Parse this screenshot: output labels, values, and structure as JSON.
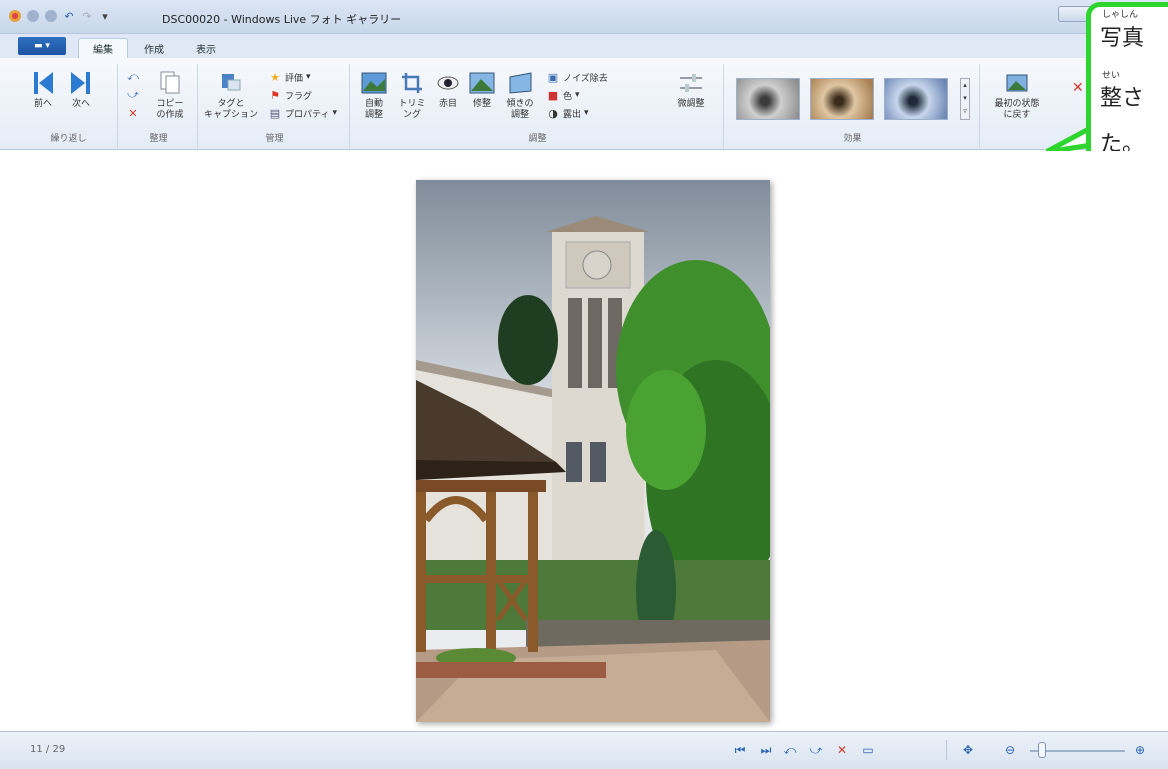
{
  "window": {
    "title": "DSC00020 - Windows Live フォト ギャラリー"
  },
  "tabs": [
    {
      "label": "編集",
      "active": true
    },
    {
      "label": "作成",
      "active": false
    },
    {
      "label": "表示",
      "active": false
    }
  ],
  "ribbon": {
    "navigate": {
      "prev": "前へ",
      "next": "次へ",
      "group": "繰り返し"
    },
    "organize": {
      "copy": "コピー\nの作成",
      "group": "整理"
    },
    "manage": {
      "tag_caption": "タグと\nキャプション",
      "rate": "評価",
      "flag": "フラグ",
      "properties": "プロパティ",
      "group": "管理"
    },
    "adjust": {
      "auto": "自動\n調整",
      "crop": "トリミ\nング",
      "redeye": "赤目",
      "retouch": "修整",
      "straighten": "傾きの\n調整",
      "noise": "ノイズ除去",
      "color": "色",
      "exposure": "露出",
      "fine_tune": "微調整",
      "group": "調整"
    },
    "effects": {
      "group": "効果"
    },
    "revert": {
      "label": "最初の状態\nに戻す"
    }
  },
  "callout": {
    "ruby1": "しゃしん",
    "line1": "写真",
    "ruby2": "せい",
    "line2": "整さ",
    "line3": "た。"
  },
  "status": {
    "counter": "11 / 29"
  },
  "colors": {
    "accent": "#2fd52f",
    "ribbon_bg": "#e4ecf6",
    "brand_blue": "#2b64b3"
  }
}
